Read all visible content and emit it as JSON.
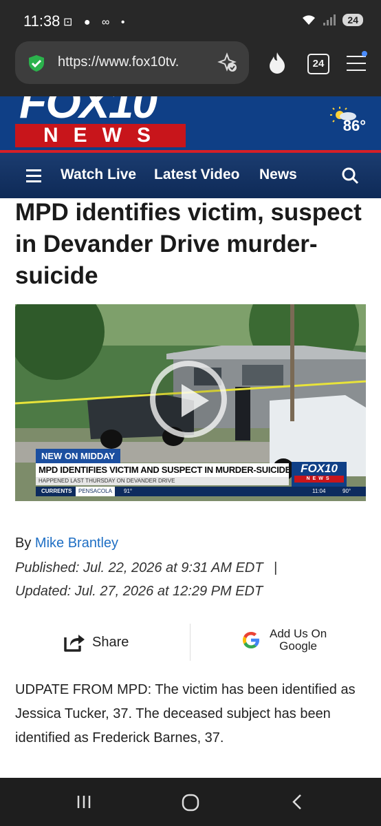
{
  "status_bar": {
    "time": "11:38",
    "battery": "24"
  },
  "browser": {
    "url": "https://www.fox10tv.",
    "tab_count": "24"
  },
  "site": {
    "logo_top": "FOX10",
    "logo_bottom": "NEWS",
    "temperature": "86°",
    "nav": [
      "Watch Live",
      "Latest Video",
      "News"
    ]
  },
  "article": {
    "headline": "MPD identifies victim, suspect in Devander Drive murder-suicide",
    "byline_prefix": "By",
    "author": "Mike Brantley",
    "published": "Published: Jul. 22, 2026 at 9:31 AM EDT",
    "updated": "Updated: Jul. 27, 2026 at 12:29 PM EDT",
    "separator": "|",
    "body": "UDPATE FROM MPD: The victim has been identified as Jessica Tucker, 37. The deceased subject has been identified as Frederick Barnes, 37."
  },
  "video": {
    "tag": "NEW ON MIDDAY",
    "lower_third": "MPD IDENTIFIES VICTIM AND SUSPECT IN MURDER-SUICIDE",
    "subline": "HAPPENED LAST THURSDAY ON DEVANDER DRIVE",
    "logo_top": "FOX10",
    "logo_bottom": "NEWS",
    "ticker_label": "CURRENTS",
    "ticker_city": "PENSACOLA",
    "ticker_temp": "91°",
    "ticker_time": "11:04",
    "ticker_temp2": "90°"
  },
  "share": {
    "share_label": "Share",
    "google_line1": "Add Us On",
    "google_line2": "Google"
  },
  "colors": {
    "brand_blue": "#0f3f86",
    "brand_red": "#c8151b",
    "link": "#1f6fc4"
  }
}
